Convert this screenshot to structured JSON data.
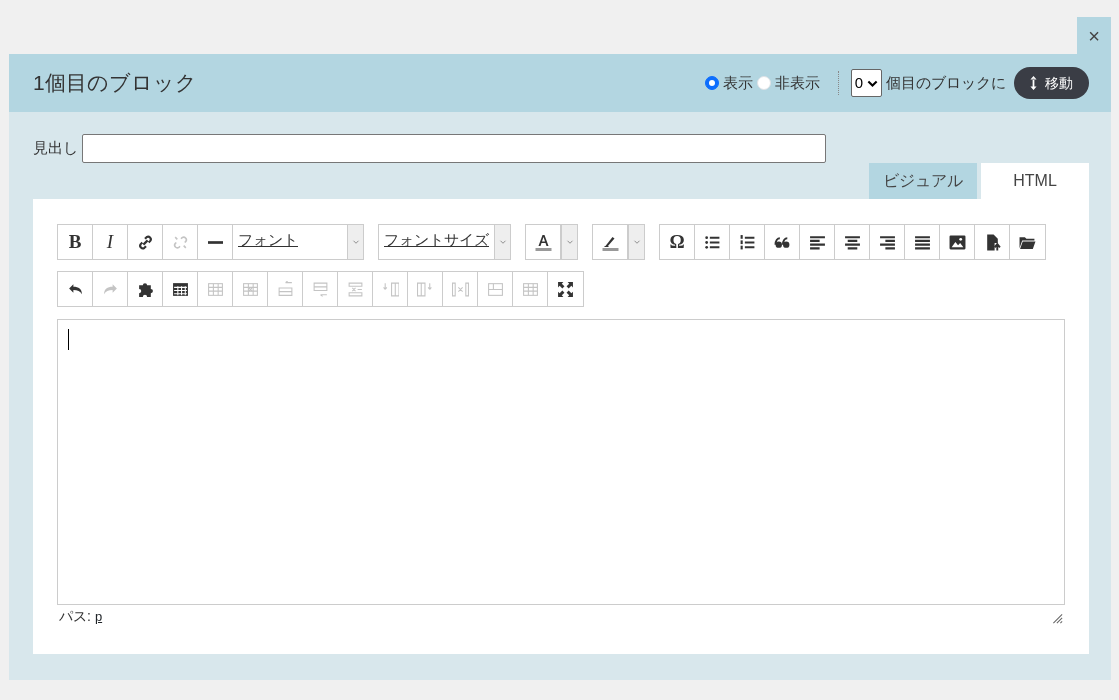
{
  "window": {
    "close": "×"
  },
  "header": {
    "title": "1個目のブロック",
    "visibility": [
      {
        "label": "表示",
        "selected": true
      },
      {
        "label": "非表示",
        "selected": false
      }
    ],
    "position_select": {
      "value": "0"
    },
    "position_label": "個目のブロックに",
    "move_button": "移動"
  },
  "heading_field": {
    "label": "見出し"
  },
  "tabs": [
    {
      "label": "ビジュアル",
      "selected": true
    },
    {
      "label": "HTML",
      "selected": false
    }
  ],
  "toolbar": {
    "rows": [
      [
        {
          "items": [
            {
              "kind": "char",
              "text": "B",
              "disabled": false
            },
            {
              "kind": "char",
              "text": "I",
              "disabled": false
            },
            {
              "kind": "link",
              "disabled": false
            },
            {
              "kind": "unlink",
              "disabled": true
            },
            {
              "kind": "rule",
              "disabled": false
            },
            {
              "kind": "select",
              "text": "フォント"
            }
          ]
        },
        {
          "items": [
            {
              "kind": "select",
              "text": "フォントサイズ"
            }
          ]
        },
        {
          "items": [
            {
              "kind": "text-color",
              "disabled": false
            }
          ]
        },
        {
          "items": [
            {
              "kind": "highlight",
              "disabled": false
            }
          ]
        },
        {
          "items": [
            {
              "kind": "char",
              "text": "Ω",
              "disabled": false
            },
            {
              "kind": "bullets",
              "disabled": false
            },
            {
              "kind": "numbers",
              "disabled": false
            },
            {
              "kind": "quote",
              "disabled": false
            },
            {
              "kind": "align-left",
              "disabled": false
            },
            {
              "kind": "align-center",
              "disabled": false
            },
            {
              "kind": "align-right",
              "disabled": false
            },
            {
              "kind": "justify",
              "disabled": false
            },
            {
              "kind": "image",
              "disabled": false
            },
            {
              "kind": "upload",
              "disabled": false
            },
            {
              "kind": "folder",
              "disabled": false
            }
          ]
        }
      ],
      [
        {
          "items": [
            {
              "kind": "undo",
              "disabled": false
            },
            {
              "kind": "redo",
              "disabled": true
            },
            {
              "kind": "puzzle",
              "disabled": false
            },
            {
              "kind": "table",
              "disabled": false
            },
            {
              "kind": "table-props",
              "disabled": true
            },
            {
              "kind": "table-delete",
              "disabled": true
            },
            {
              "kind": "row-above",
              "disabled": true
            },
            {
              "kind": "row-below",
              "disabled": true
            },
            {
              "kind": "row-delete",
              "disabled": true
            },
            {
              "kind": "col-left",
              "disabled": true
            },
            {
              "kind": "col-right",
              "disabled": true
            },
            {
              "kind": "col-delete",
              "disabled": true
            },
            {
              "kind": "cell-split",
              "disabled": true
            },
            {
              "kind": "cell-merge",
              "disabled": true
            },
            {
              "kind": "fullscreen",
              "disabled": false
            }
          ]
        }
      ]
    ]
  },
  "editor": {
    "path_label": "パス:",
    "path": "p"
  }
}
